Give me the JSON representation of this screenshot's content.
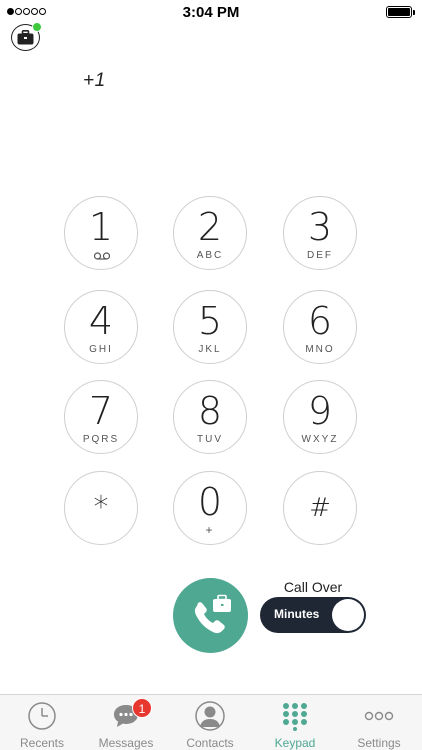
{
  "status_bar": {
    "time": "3:04 PM",
    "signal_bars": 1,
    "signal_total": 5
  },
  "dial": {
    "number": "+1"
  },
  "keypad": [
    {
      "digit": "1",
      "letters": ""
    },
    {
      "digit": "2",
      "letters": "ABC"
    },
    {
      "digit": "3",
      "letters": "DEF"
    },
    {
      "digit": "4",
      "letters": "GHI"
    },
    {
      "digit": "5",
      "letters": "JKL"
    },
    {
      "digit": "6",
      "letters": "MNO"
    },
    {
      "digit": "7",
      "letters": "PQRS"
    },
    {
      "digit": "8",
      "letters": "TUV"
    },
    {
      "digit": "9",
      "letters": "WXYZ"
    },
    {
      "digit": "*",
      "letters": ""
    },
    {
      "digit": "0",
      "letters": "+"
    },
    {
      "digit": "#",
      "letters": ""
    }
  ],
  "call_over": {
    "label": "Call Over",
    "toggle_label": "Minutes"
  },
  "colors": {
    "accent": "#4ea892",
    "toggle_bg": "#1f2735",
    "badge": "#e8372f",
    "presence": "#3fc93f"
  },
  "tabs": [
    {
      "label": "Recents",
      "icon": "clock-icon"
    },
    {
      "label": "Messages",
      "icon": "message-bubble-icon",
      "badge": "1"
    },
    {
      "label": "Contacts",
      "icon": "person-icon"
    },
    {
      "label": "Keypad",
      "icon": "keypad-grid-icon",
      "active": true
    },
    {
      "label": "Settings",
      "icon": "ellipsis-icon"
    }
  ]
}
